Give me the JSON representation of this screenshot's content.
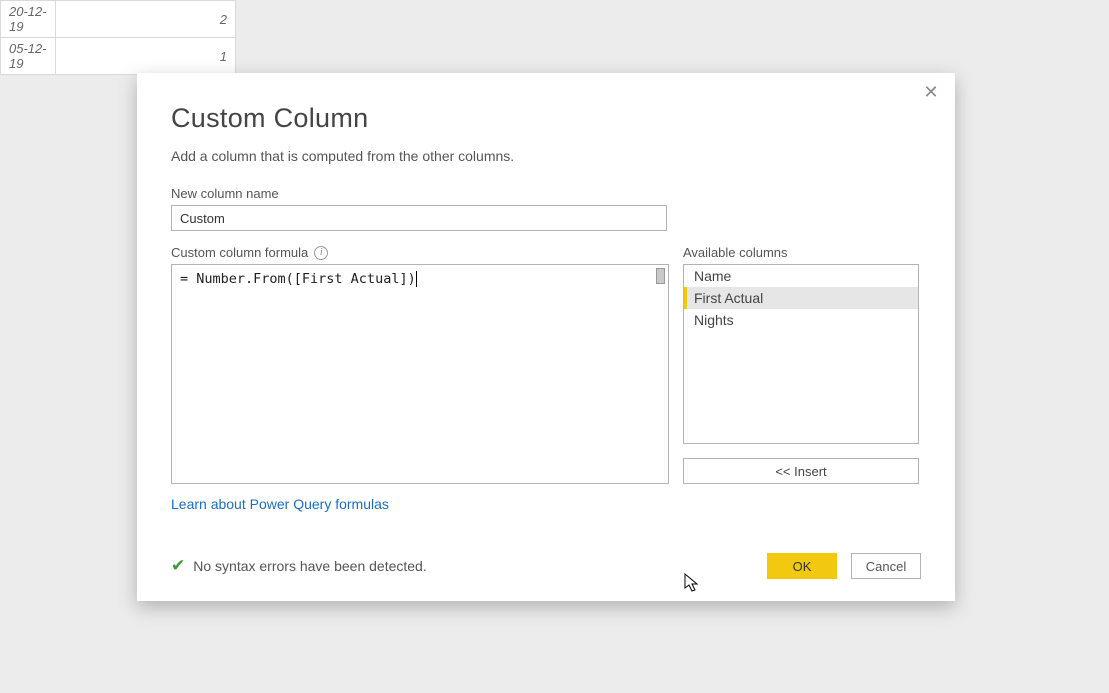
{
  "bg_table": {
    "rows": [
      {
        "date": "20-12-19",
        "value": "2"
      },
      {
        "date": "05-12-19",
        "value": "1"
      }
    ]
  },
  "dialog": {
    "title": "Custom Column",
    "subtitle": "Add a column that is computed from the other columns.",
    "name_label": "New column name",
    "name_value": "Custom",
    "formula_label": "Custom column formula",
    "formula_value": "= Number.From([First Actual])",
    "available_label": "Available columns",
    "available_columns": [
      "Name",
      "First Actual",
      "Nights"
    ],
    "selected_column_index": 1,
    "insert_label": "<< Insert",
    "learn_link": "Learn about Power Query formulas",
    "status_text": "No syntax errors have been detected.",
    "ok_label": "OK",
    "cancel_label": "Cancel"
  }
}
